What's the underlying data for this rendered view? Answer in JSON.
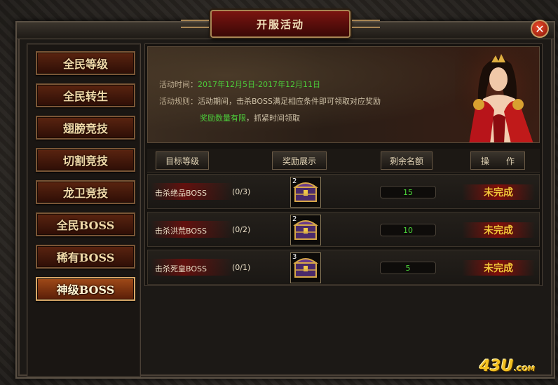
{
  "window": {
    "title": "开服活动"
  },
  "sidebar": {
    "items": [
      {
        "label": "全民等级"
      },
      {
        "label": "全民转生"
      },
      {
        "label": "翅膀竞技"
      },
      {
        "label": "切割竞技"
      },
      {
        "label": "龙卫竞技"
      },
      {
        "label": "全民BOSS"
      },
      {
        "label": "稀有BOSS"
      },
      {
        "label": "神级BOSS",
        "active": true
      }
    ]
  },
  "banner": {
    "time_label": "活动时间：",
    "time_value": "2017年12月5日-2017年12月11日",
    "rule_label": "活动规则：",
    "rule_value": "活动期间，击杀BOSS满足相应条件即可领取对应奖励",
    "note_highlight": "奖励数量有限",
    "note_rest": "，抓紧时间领取"
  },
  "table": {
    "headers": [
      "目标等级",
      "奖励展示",
      "剩余名额",
      "操　　作"
    ],
    "rows": [
      {
        "name": "击杀绝品BOSS",
        "progress": "(0/3)",
        "chest_count": "2",
        "remaining": "15",
        "status": "未完成"
      },
      {
        "name": "击杀洪荒BOSS",
        "progress": "(0/2)",
        "chest_count": "2",
        "remaining": "10",
        "status": "未完成"
      },
      {
        "name": "击杀死皇BOSS",
        "progress": "(0/1)",
        "chest_count": "3",
        "remaining": "5",
        "status": "未完成"
      }
    ]
  },
  "watermark": {
    "main": "43U",
    "suffix": ".COM"
  },
  "icons": {
    "close": "close-icon",
    "chest": "treasure-chest-icon",
    "portrait": "character-portrait"
  },
  "colors": {
    "accent_red": "#8a1408",
    "text_gold": "#f0d9a8",
    "green": "#4ccc3a",
    "status_yellow": "#f0c83a"
  }
}
